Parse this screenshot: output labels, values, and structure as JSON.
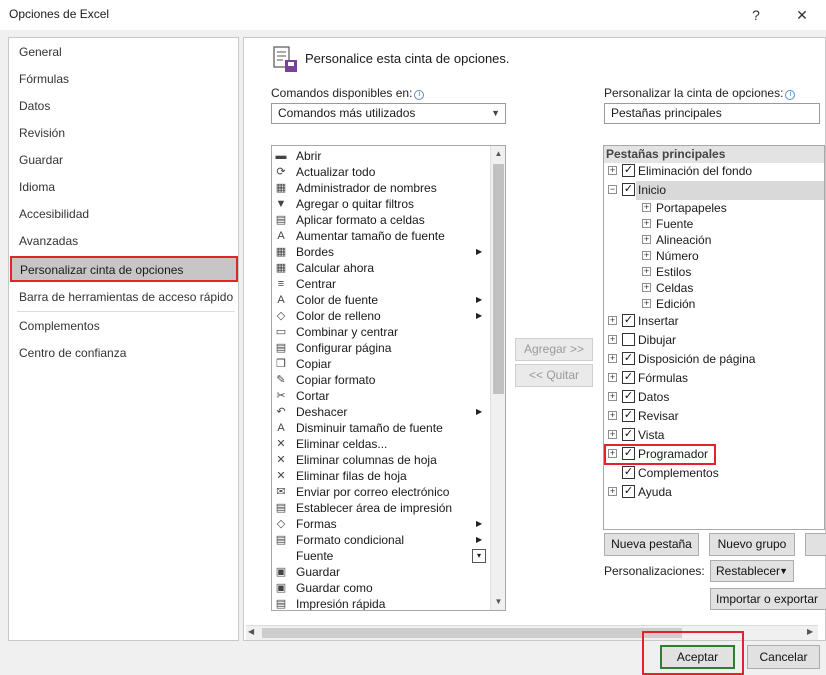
{
  "window": {
    "title": "Opciones de Excel",
    "help_glyph": "?",
    "close_glyph": "✕"
  },
  "nav": {
    "items": [
      "General",
      "Fórmulas",
      "Datos",
      "Revisión",
      "Guardar",
      "Idioma",
      "Accesibilidad",
      "Avanzadas",
      "Personalizar cinta de opciones",
      "Barra de herramientas de acceso rápido",
      "Complementos",
      "Centro de confianza"
    ],
    "selected_index": 8
  },
  "main": {
    "heading": "Personalice esta cinta de opciones.",
    "commands_label": "Comandos disponibles en:",
    "commands_combo": "Comandos más utilizados",
    "customize_label": "Personalizar la cinta de opciones:",
    "customize_combo": "Pestañas principales",
    "info_glyph": "i",
    "commands": [
      {
        "label": "Abrir",
        "icon": "folder-icon",
        "glyph": "▬",
        "sub": false
      },
      {
        "label": "Actualizar todo",
        "icon": "refresh-icon",
        "glyph": "⟳",
        "sub": false
      },
      {
        "label": "Administrador de nombres",
        "icon": "name-manager-icon",
        "glyph": "▦",
        "sub": false
      },
      {
        "label": "Agregar o quitar filtros",
        "icon": "filter-icon",
        "glyph": "▼",
        "sub": false
      },
      {
        "label": "Aplicar formato a celdas",
        "icon": "format-cells-icon",
        "glyph": "▤",
        "sub": false
      },
      {
        "label": "Aumentar tamaño de fuente",
        "icon": "font-grow-icon",
        "glyph": "A",
        "sub": false
      },
      {
        "label": "Bordes",
        "icon": "borders-icon",
        "glyph": "▦",
        "sub": true
      },
      {
        "label": "Calcular ahora",
        "icon": "calculator-icon",
        "glyph": "▦",
        "sub": false
      },
      {
        "label": "Centrar",
        "icon": "align-center-icon",
        "glyph": "≡",
        "sub": false
      },
      {
        "label": "Color de fuente",
        "icon": "font-color-icon",
        "glyph": "A",
        "sub": true
      },
      {
        "label": "Color de relleno",
        "icon": "fill-color-icon",
        "glyph": "◇",
        "sub": true
      },
      {
        "label": "Combinar y centrar",
        "icon": "merge-center-icon",
        "glyph": "▭",
        "sub": false
      },
      {
        "label": "Configurar página",
        "icon": "page-setup-icon",
        "glyph": "▤",
        "sub": false
      },
      {
        "label": "Copiar",
        "icon": "copy-icon",
        "glyph": "❐",
        "sub": false
      },
      {
        "label": "Copiar formato",
        "icon": "format-painter-icon",
        "glyph": "✎",
        "sub": false
      },
      {
        "label": "Cortar",
        "icon": "cut-icon",
        "glyph": "✂",
        "sub": false
      },
      {
        "label": "Deshacer",
        "icon": "undo-icon",
        "glyph": "↶",
        "sub": true
      },
      {
        "label": "Disminuir tamaño de fuente",
        "icon": "font-shrink-icon",
        "glyph": "A",
        "sub": false
      },
      {
        "label": "Eliminar celdas...",
        "icon": "delete-cells-icon",
        "glyph": "✕",
        "sub": false
      },
      {
        "label": "Eliminar columnas de hoja",
        "icon": "delete-columns-icon",
        "glyph": "✕",
        "sub": false
      },
      {
        "label": "Eliminar filas de hoja",
        "icon": "delete-rows-icon",
        "glyph": "✕",
        "sub": false
      },
      {
        "label": "Enviar por correo electrónico",
        "icon": "email-icon",
        "glyph": "✉",
        "sub": false
      },
      {
        "label": "Establecer área de impresión",
        "icon": "print-area-icon",
        "glyph": "▤",
        "sub": false
      },
      {
        "label": "Formas",
        "icon": "shapes-icon",
        "glyph": "◇",
        "sub": true
      },
      {
        "label": "Formato condicional",
        "icon": "conditional-format-icon",
        "glyph": "▤",
        "sub": true
      },
      {
        "label": "Fuente",
        "icon": "font-icon",
        "glyph": "",
        "sub": false,
        "combo": true
      },
      {
        "label": "Guardar",
        "icon": "save-icon",
        "glyph": "▣",
        "sub": false
      },
      {
        "label": "Guardar como",
        "icon": "save-as-icon",
        "glyph": "▣",
        "sub": false
      },
      {
        "label": "Impresión rápida",
        "icon": "quick-print-icon",
        "glyph": "▤",
        "sub": false
      }
    ],
    "add_button": "Agregar >>",
    "remove_button": "<< Quitar",
    "tree_header": "Pestañas principales",
    "tree": [
      {
        "label": "Eliminación del fondo",
        "level": 0,
        "expander": "+",
        "checked": true
      },
      {
        "label": "Inicio",
        "level": 0,
        "expander": "−",
        "checked": true,
        "selected": true
      },
      {
        "label": "Portapapeles",
        "level": 1,
        "expander": "+",
        "checked": null
      },
      {
        "label": "Fuente",
        "level": 1,
        "expander": "+",
        "checked": null
      },
      {
        "label": "Alineación",
        "level": 1,
        "expander": "+",
        "checked": null
      },
      {
        "label": "Número",
        "level": 1,
        "expander": "+",
        "checked": null
      },
      {
        "label": "Estilos",
        "level": 1,
        "expander": "+",
        "checked": null
      },
      {
        "label": "Celdas",
        "level": 1,
        "expander": "+",
        "checked": null
      },
      {
        "label": "Edición",
        "level": 1,
        "expander": "+",
        "checked": null
      },
      {
        "label": "Insertar",
        "level": 0,
        "expander": "+",
        "checked": true
      },
      {
        "label": "Dibujar",
        "level": 0,
        "expander": "+",
        "checked": false
      },
      {
        "label": "Disposición de página",
        "level": 0,
        "expander": "+",
        "checked": true
      },
      {
        "label": "Fórmulas",
        "level": 0,
        "expander": "+",
        "checked": true
      },
      {
        "label": "Datos",
        "level": 0,
        "expander": "+",
        "checked": true
      },
      {
        "label": "Revisar",
        "level": 0,
        "expander": "+",
        "checked": true
      },
      {
        "label": "Vista",
        "level": 0,
        "expander": "+",
        "checked": true
      },
      {
        "label": "Programador",
        "level": 0,
        "expander": "+",
        "checked": true,
        "highlight": true
      },
      {
        "label": "Complementos",
        "level": 0,
        "expander": "",
        "checked": true
      },
      {
        "label": "Ayuda",
        "level": 0,
        "expander": "+",
        "checked": true
      }
    ],
    "new_tab_button": "Nueva pestaña",
    "new_group_button": "Nuevo grupo",
    "customizations_label": "Personalizaciones:",
    "reset_button": "Restablecer",
    "import_export_button": "Importar o exportar"
  },
  "footer": {
    "ok_button": "Aceptar",
    "cancel_button": "Cancelar"
  },
  "colors": {
    "accent_red": "#e2232b",
    "selected_gray": "#c6c6c6",
    "ok_border": "#2e7d32"
  }
}
